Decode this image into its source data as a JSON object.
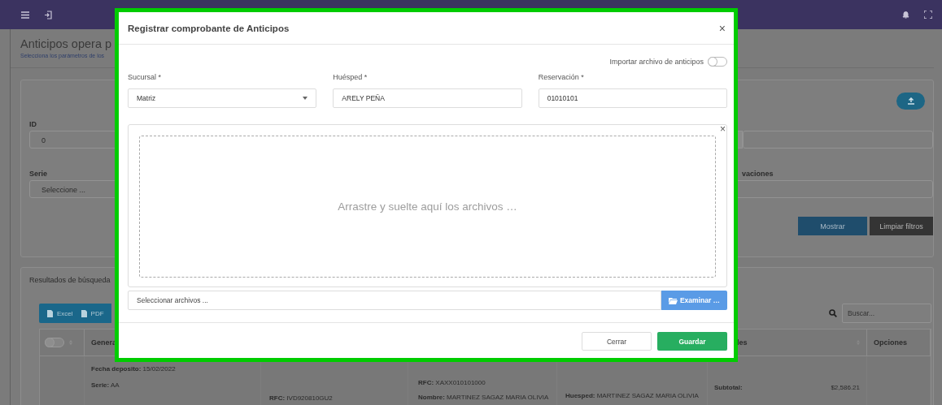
{
  "page": {
    "title": "Anticipos opera p",
    "subtitle": "Selecciona los parámetros de los"
  },
  "filters": {
    "fields": [
      {
        "label": "ID",
        "value": "0"
      },
      {
        "label": "Serie",
        "value": "Seleccione ..."
      }
    ],
    "right_label": "vaciones",
    "buttons": [
      "Mostrar",
      "Limpiar filtros"
    ]
  },
  "results": {
    "title": "Resultados de búsqueda",
    "export_buttons": [
      "Excel",
      "PDF"
    ],
    "search": {
      "placeholder": "Buscar..."
    },
    "table": {
      "select_all_on": false,
      "columns": [
        "Genera",
        "les",
        "Opciones"
      ],
      "cells": [
        [],
        [
          {
            "text": "**Fecha deposito:** 15/02/2022"
          },
          {
            "text": "**Serie:** AA"
          }
        ],
        [
          {
            "text": "**RFC:** IVD920810GU2"
          }
        ],
        [
          {
            "text": "**RFC:** XAXX010101000"
          },
          {
            "text": "**Nombre:** MARTINEZ SAGAZ MARIA OLIVIA"
          }
        ],
        [
          {
            "text": "**Huesped:** MARTINEZ SAGAZ MARIA OLIVIA"
          }
        ],
        [
          {
            "text": "Subtotal:"
          },
          {
            "text": "$2,586.21"
          }
        ],
        []
      ]
    }
  },
  "modal": {
    "title": "Registrar comprobante de Anticipos",
    "close": "×",
    "import_toggle": {
      "label": "Importar archivo de anticipos",
      "on": false
    },
    "fields": [
      {
        "label": "Sucursal *",
        "value": "Matriz",
        "kind": "select"
      },
      {
        "label": "Huésped *",
        "value": "ARELY PEÑA",
        "kind": "text"
      },
      {
        "label": "Reservación *",
        "value": "01010101",
        "kind": "text"
      }
    ],
    "dropzone": {
      "text": "Arrastre y suelte aquí los archivos …",
      "close": "×"
    },
    "file": {
      "placeholder": "Seleccionar archivos ...",
      "button": "Examinar …"
    },
    "buttons": [
      {
        "label": "Cerrar",
        "kind": "secondary"
      },
      {
        "label": "Guardar",
        "kind": "primary"
      }
    ]
  }
}
